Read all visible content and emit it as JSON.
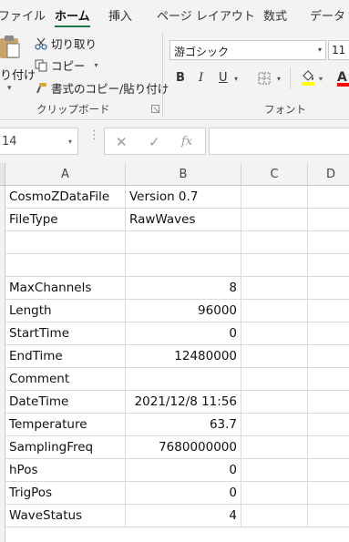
{
  "ribbon_tabs": [
    {
      "label": "ファイル",
      "active": false
    },
    {
      "label": "ホーム",
      "active": true
    },
    {
      "label": "挿入",
      "active": false
    },
    {
      "label": "ページ レイアウト",
      "active": false
    },
    {
      "label": "数式",
      "active": false
    },
    {
      "label": "データ",
      "active": false
    }
  ],
  "clipboard": {
    "paste_label": "り付け",
    "cut_label": "切り取り",
    "copy_label": "コピー",
    "format_painter_label": "書式のコピー/貼り付け",
    "group_label": "クリップボード"
  },
  "font": {
    "name": "游ゴシック",
    "size": "11",
    "bold": "B",
    "italic": "I",
    "underline": "U",
    "font_color_glyph": "A",
    "group_label": "フォント",
    "highlight_color": "#ffff00",
    "font_color": "#ff0000"
  },
  "formula_bar": {
    "name_box": "14",
    "formula": ""
  },
  "columns": [
    "A",
    "B",
    "C",
    "D"
  ],
  "rows": [
    {
      "a": "CosmoZDataFile",
      "b": "Version 0.7",
      "b_align": "left"
    },
    {
      "a": "FileType",
      "b": "RawWaves",
      "b_align": "left"
    },
    {
      "a": "",
      "b": "",
      "b_align": "left"
    },
    {
      "a": "",
      "b": "",
      "b_align": "left"
    },
    {
      "a": "MaxChannels",
      "b": "8",
      "b_align": "right"
    },
    {
      "a": "Length",
      "b": "96000",
      "b_align": "right"
    },
    {
      "a": "StartTime",
      "b": "0",
      "b_align": "right"
    },
    {
      "a": "EndTime",
      "b": "12480000",
      "b_align": "right"
    },
    {
      "a": "Comment",
      "b": "",
      "b_align": "left"
    },
    {
      "a": "DateTime",
      "b": "2021/12/8 11:56",
      "b_align": "right"
    },
    {
      "a": "Temperature",
      "b": "63.7",
      "b_align": "right"
    },
    {
      "a": "SamplingFreq",
      "b": "7680000000",
      "b_align": "right"
    },
    {
      "a": "hPos",
      "b": "0",
      "b_align": "right"
    },
    {
      "a": "TrigPos",
      "b": "0",
      "b_align": "right"
    },
    {
      "a": "WaveStatus",
      "b": "4",
      "b_align": "right"
    }
  ],
  "accent_color": "#217346"
}
